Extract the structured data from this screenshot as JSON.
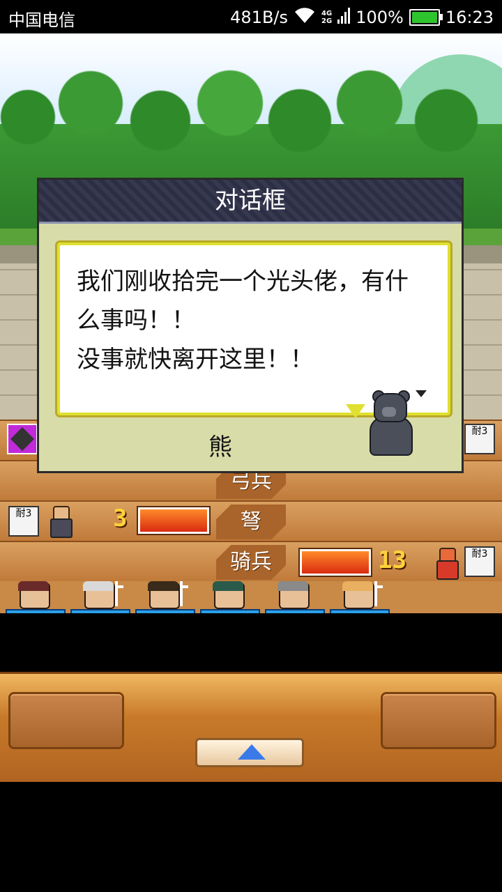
{
  "status_bar": {
    "carrier": "中国电信",
    "net_speed": "481B/s",
    "net_type_top": "4G",
    "net_type_bottom": "2G",
    "battery": "100%",
    "time": "16:23"
  },
  "dialog": {
    "title": "对话框",
    "message": "我们刚收拾完一个光头佬，有什\n么事吗！！\n没事就快离开这里！！",
    "speaker": "熊"
  },
  "battle": {
    "lanes": [
      {
        "label": "弓兵"
      },
      {
        "label": "弩",
        "troop_count": "3",
        "hp_fraction": 1.0
      },
      {
        "label": "骑兵",
        "troop_count": "13",
        "hp_fraction": 1.0
      }
    ],
    "endurance_tag": "耐3",
    "heroes": [
      {
        "name": "hero-1",
        "hair": "#6a2a2a"
      },
      {
        "name": "hero-2",
        "hair": "#d8d8d8"
      },
      {
        "name": "hero-3",
        "hair": "#3a2a1a"
      },
      {
        "name": "hero-4",
        "hair": "#2a5a4a"
      },
      {
        "name": "hero-5",
        "hair": "#8a8a8a"
      },
      {
        "name": "hero-6",
        "hair": "#e8b060"
      }
    ]
  },
  "colors": {
    "dialog_bg": "#d8dca8",
    "title_bar": "#2c2e46",
    "speech_border": "#e0e030",
    "hp_bar": "#e8401a",
    "mp_bar": "#2aa0e8"
  },
  "controls": {
    "up_button_icon": "up-triangle-icon"
  }
}
